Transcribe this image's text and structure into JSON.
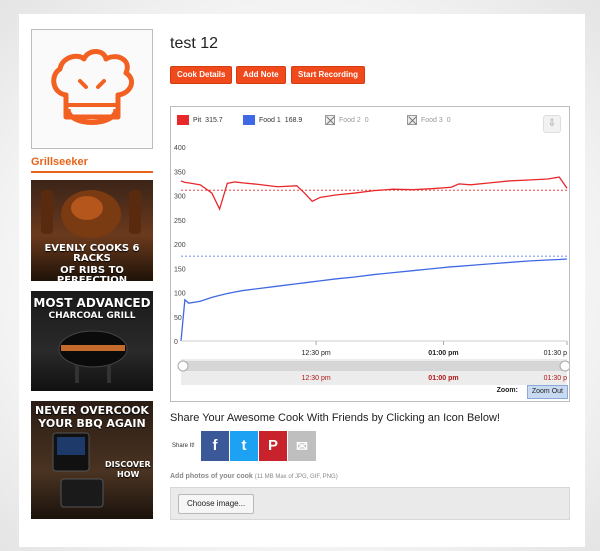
{
  "profile": {
    "user_name": "Grillseeker"
  },
  "ads": [
    {
      "lines": [
        "EVENLY COOKS 6 RACKS",
        "OF RIBS TO PERFECTION"
      ]
    },
    {
      "lines": [
        "MOST ADVANCED",
        "CHARCOAL GRILL"
      ]
    },
    {
      "lines": [
        "NEVER OVERCOOK",
        "YOUR BBQ AGAIN",
        "DISCOVER",
        "HOW"
      ]
    }
  ],
  "cook": {
    "title": "test 12",
    "buttons": {
      "details": "Cook Details",
      "note": "Add Note",
      "record": "Start Recording"
    }
  },
  "chart_data": {
    "type": "line",
    "legend": [
      {
        "label": "Pit",
        "value": "315.7",
        "color": "#e8282b",
        "enabled": true
      },
      {
        "label": "Food 1",
        "value": "168.9",
        "color": "#3f68e4",
        "enabled": true
      },
      {
        "label": "Food 2",
        "value": "0",
        "color": "#999999",
        "enabled": false
      },
      {
        "label": "Food 3",
        "value": "0",
        "color": "#999999",
        "enabled": false
      }
    ],
    "y_ticks": [
      "400",
      "350",
      "300",
      "250",
      "200",
      "150",
      "100",
      "50",
      "0"
    ],
    "ylim": [
      0,
      400
    ],
    "x_ticks": [
      "12:30 pm",
      "01:00 pm",
      "01:30 p"
    ],
    "navigator_ticks": [
      "12:30 pm",
      "01:00 pm",
      "01:30 p"
    ],
    "x": [
      0,
      0.01,
      0.02,
      0.05,
      0.08,
      0.1,
      0.12,
      0.14,
      0.16,
      0.2,
      0.25,
      0.3,
      0.32,
      0.34,
      0.36,
      0.4,
      0.45,
      0.5,
      0.55,
      0.6,
      0.65,
      0.7,
      0.72,
      0.75,
      0.8,
      0.85,
      0.9,
      0.95,
      0.98,
      1.0
    ],
    "series": [
      {
        "name": "Pit",
        "color": "#e8282b",
        "setpoint": 311,
        "values": [
          330,
          327,
          326,
          322,
          305,
          272,
          325,
          328,
          326,
          323,
          318,
          320,
          305,
          288,
          296,
          301,
          305,
          310,
          313,
          312,
          314,
          317,
          324,
          322,
          326,
          330,
          332,
          334,
          338,
          315
        ]
      },
      {
        "name": "Food 1",
        "color": "#3f68e4",
        "setpoint": 175,
        "values": [
          0,
          85,
          78,
          82,
          90,
          94,
          98,
          101,
          104,
          108,
          113,
          118,
          120,
          122,
          124,
          128,
          132,
          137,
          141,
          145,
          149,
          153,
          154,
          156,
          159,
          162,
          165,
          167,
          168,
          169
        ]
      }
    ]
  },
  "zoom": {
    "label": "Zoom:",
    "button": "Zoom Out"
  },
  "share": {
    "heading": "Share Your Awesome Cook With Friends by Clicking an Icon Below!",
    "label": "Share It!",
    "icons": [
      {
        "name": "facebook",
        "glyph": "f",
        "color": "#3b5998"
      },
      {
        "name": "twitter",
        "glyph": "t",
        "color": "#1da1f2"
      },
      {
        "name": "pinterest",
        "glyph": "P",
        "color": "#c8232c"
      },
      {
        "name": "email",
        "glyph": "✉",
        "color": "#bfbfbf"
      }
    ]
  },
  "photos": {
    "label": "Add photos of your cook",
    "note": "(11 MB Max of JPG, GIF, PNG)",
    "button": "Choose image..."
  }
}
